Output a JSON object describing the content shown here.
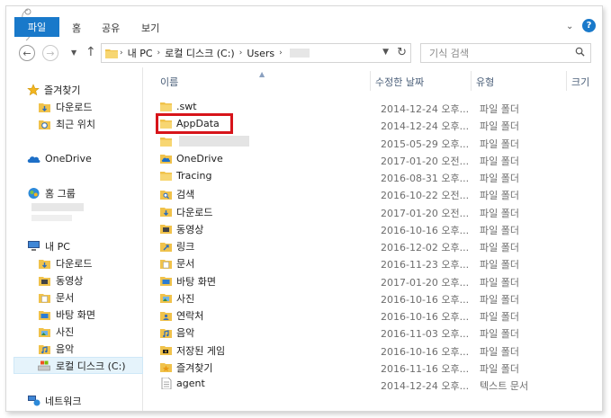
{
  "ribbon": {
    "tabs": [
      "파일",
      "홈",
      "공유",
      "보기"
    ],
    "help": "?"
  },
  "address": {
    "segments": [
      "내 PC",
      "로컬 디스크 (C:)",
      "Users"
    ],
    "search_placeholder": "기식 검색"
  },
  "nav": {
    "quick_access": "즐겨찾기",
    "quick_items": [
      "다운로드",
      "최근 위치"
    ],
    "onedrive": "OneDrive",
    "homegroup": "홈 그룹",
    "this_pc": "내 PC",
    "pc_items": [
      "다운로드",
      "동영상",
      "문서",
      "바탕 화면",
      "사진",
      "음악",
      "로컬 디스크 (C:)"
    ],
    "network": "네트워크"
  },
  "columns": [
    "이름",
    "수정한 날짜",
    "유형",
    "크기"
  ],
  "files": [
    {
      "name": ".swt",
      "date": "2014-12-24 오후...",
      "type": "파일 폴더",
      "icon": "folder-icon"
    },
    {
      "name": "AppData",
      "date": "2014-12-24 오후...",
      "type": "파일 폴더",
      "icon": "folder-icon"
    },
    {
      "name": "",
      "date": "2015-05-29 오후...",
      "type": "파일 폴더",
      "icon": "folder-icon"
    },
    {
      "name": "OneDrive",
      "date": "2017-01-20 오전...",
      "type": "파일 폴더",
      "icon": "onedrive-folder-icon"
    },
    {
      "name": "Tracing",
      "date": "2016-08-31 오후...",
      "type": "파일 폴더",
      "icon": "folder-icon"
    },
    {
      "name": "검색",
      "date": "2016-10-22 오전...",
      "type": "파일 폴더",
      "icon": "search-folder-icon"
    },
    {
      "name": "다운로드",
      "date": "2017-01-20 오전...",
      "type": "파일 폴더",
      "icon": "download-folder-icon"
    },
    {
      "name": "동영상",
      "date": "2016-10-16 오후...",
      "type": "파일 폴더",
      "icon": "video-folder-icon"
    },
    {
      "name": "링크",
      "date": "2016-12-02 오후...",
      "type": "파일 폴더",
      "icon": "links-folder-icon"
    },
    {
      "name": "문서",
      "date": "2016-11-23 오후...",
      "type": "파일 폴더",
      "icon": "documents-folder-icon"
    },
    {
      "name": "바탕 화면",
      "date": "2017-01-20 오후...",
      "type": "파일 폴더",
      "icon": "desktop-folder-icon"
    },
    {
      "name": "사진",
      "date": "2016-10-16 오후...",
      "type": "파일 폴더",
      "icon": "pictures-folder-icon"
    },
    {
      "name": "연락처",
      "date": "2016-10-16 오후...",
      "type": "파일 폴더",
      "icon": "contacts-folder-icon"
    },
    {
      "name": "음악",
      "date": "2016-11-03 오후...",
      "type": "파일 폴더",
      "icon": "music-folder-icon"
    },
    {
      "name": "저장된 게임",
      "date": "2016-10-16 오후...",
      "type": "파일 폴더",
      "icon": "saved-games-folder-icon"
    },
    {
      "name": "즐겨찾기",
      "date": "2016-11-16 오후...",
      "type": "파일 폴더",
      "icon": "favorites-folder-icon"
    },
    {
      "name": "agent",
      "date": "2014-12-24 오후...",
      "type": "텍스트 문서",
      "icon": "text-file-icon"
    }
  ],
  "colors": {
    "accent": "#1979ca",
    "highlight": "#d7141a",
    "folder": "#f0c24b"
  }
}
